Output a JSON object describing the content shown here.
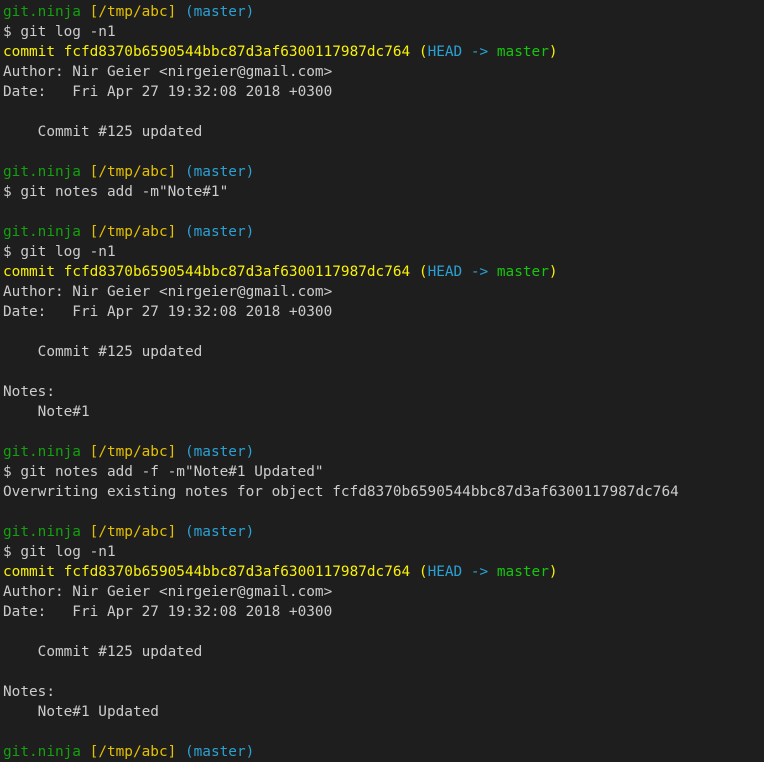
{
  "prompt": {
    "host": "git.ninja",
    "path": "[/tmp/abc]",
    "branch": "(master)"
  },
  "commit_block": {
    "commit_word": "commit",
    "hash": "fcfd8370b6590544bbc87d3af6300117987dc764",
    "open_paren": "(",
    "head": "HEAD",
    "arrow": "->",
    "master": "master",
    "close_paren": ")",
    "author": "Author: Nir Geier <nirgeier@gmail.com>",
    "date": "Date:   Fri Apr 27 19:32:08 2018 +0300",
    "message": "    Commit #125 updated",
    "notes_header": "Notes:"
  },
  "commands": {
    "log": "$ git log -n1",
    "notes_add": "$ git notes add -m\"Note#1\"",
    "notes_force": "$ git notes add -f -m\"Note#1 Updated\""
  },
  "outputs": {
    "overwrite": "Overwriting existing notes for object fcfd8370b6590544bbc87d3af6300117987dc764",
    "note1": "    Note#1",
    "note1_updated": "    Note#1 Updated"
  },
  "colors": {
    "background": "#1e1e1e",
    "text": "#cccccc",
    "host": "#13a10e",
    "path": "#e5c000",
    "branch": "#2aa1d3",
    "commit": "#f9f106"
  }
}
